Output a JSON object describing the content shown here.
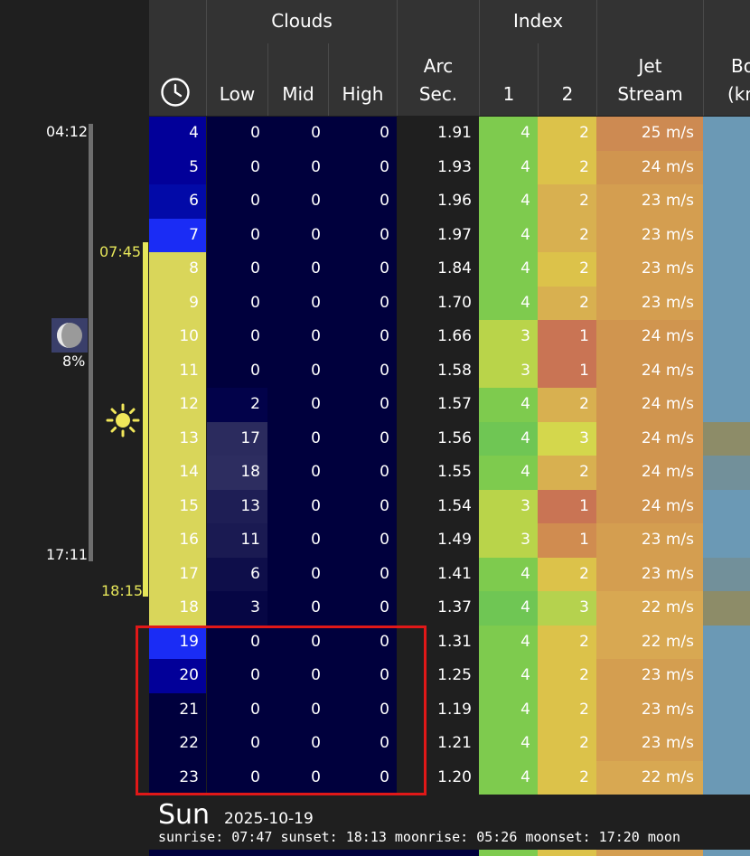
{
  "header": {
    "clouds_label": "Clouds",
    "index_label": "Index",
    "low_label": "Low",
    "mid_label": "Mid",
    "high_label": "High",
    "arc_label_1": "Arc",
    "arc_label_2": "Sec.",
    "index1_label": "1",
    "index2_label": "2",
    "jet_label_1": "Jet",
    "jet_label_2": "Stream",
    "bo_label_1": "Bo",
    "bo_label_2": "(kn"
  },
  "left_panel": {
    "moonrise": "04:12",
    "moonset": "17:11",
    "sunrise": "07:45",
    "sunset": "18:15",
    "moon_illumination": "8%"
  },
  "rows": [
    {
      "hour": "4",
      "low": "0",
      "mid": "0",
      "high": "0",
      "arc": "1.91",
      "i1": "4",
      "i2": "2",
      "jet": "25 m/s",
      "hourColor": "#020099",
      "lowColor": "#00003d",
      "i1Color": "#7ecb4e",
      "i2Color": "#dcc24a",
      "jetColor": "#cd8a52",
      "boColor": "#6b99b5"
    },
    {
      "hour": "5",
      "low": "0",
      "mid": "0",
      "high": "0",
      "arc": "1.93",
      "i1": "4",
      "i2": "2",
      "jet": "24 m/s",
      "hourColor": "#020099",
      "lowColor": "#00003d",
      "i1Color": "#7ecb4e",
      "i2Color": "#dcc24a",
      "jetColor": "#d0954f",
      "boColor": "#6b99b5"
    },
    {
      "hour": "6",
      "low": "0",
      "mid": "0",
      "high": "0",
      "arc": "1.96",
      "i1": "4",
      "i2": "2",
      "jet": "23 m/s",
      "hourColor": "#020aa8",
      "lowColor": "#00003d",
      "i1Color": "#7ecb4e",
      "i2Color": "#d8b050",
      "jetColor": "#d49e50",
      "boColor": "#6b99b5"
    },
    {
      "hour": "7",
      "low": "0",
      "mid": "0",
      "high": "0",
      "arc": "1.97",
      "i1": "4",
      "i2": "2",
      "jet": "23 m/s",
      "hourColor": "#1a2cf5",
      "lowColor": "#00003d",
      "i1Color": "#7ecb4e",
      "i2Color": "#d8b050",
      "jetColor": "#d49e50",
      "boColor": "#6b99b5"
    },
    {
      "hour": "8",
      "low": "0",
      "mid": "0",
      "high": "0",
      "arc": "1.84",
      "i1": "4",
      "i2": "2",
      "jet": "23 m/s",
      "hourColor": "#d9d65a",
      "lowColor": "#00003d",
      "i1Color": "#7ecb4e",
      "i2Color": "#dcc24a",
      "jetColor": "#d49e50",
      "boColor": "#6b99b5"
    },
    {
      "hour": "9",
      "low": "0",
      "mid": "0",
      "high": "0",
      "arc": "1.70",
      "i1": "4",
      "i2": "2",
      "jet": "23 m/s",
      "hourColor": "#d9d65a",
      "lowColor": "#00003d",
      "i1Color": "#7ecb4e",
      "i2Color": "#d8b050",
      "jetColor": "#d49e50",
      "boColor": "#6b99b5"
    },
    {
      "hour": "10",
      "low": "0",
      "mid": "0",
      "high": "0",
      "arc": "1.66",
      "i1": "3",
      "i2": "1",
      "jet": "24 m/s",
      "hourColor": "#d9d65a",
      "lowColor": "#00003d",
      "i1Color": "#b9d44a",
      "i2Color": "#c97454",
      "jetColor": "#d0954f",
      "boColor": "#6b99b5"
    },
    {
      "hour": "11",
      "low": "0",
      "mid": "0",
      "high": "0",
      "arc": "1.58",
      "i1": "3",
      "i2": "1",
      "jet": "24 m/s",
      "hourColor": "#d9d65a",
      "lowColor": "#00003d",
      "i1Color": "#b9d44a",
      "i2Color": "#c97454",
      "jetColor": "#d0954f",
      "boColor": "#6b99b5"
    },
    {
      "hour": "12",
      "low": "2",
      "mid": "0",
      "high": "0",
      "arc": "1.57",
      "i1": "4",
      "i2": "2",
      "jet": "24 m/s",
      "hourColor": "#d9d65a",
      "lowColor": "#02024a",
      "i1Color": "#7ecb4e",
      "i2Color": "#d8b050",
      "jetColor": "#d0954f",
      "boColor": "#6b99b5"
    },
    {
      "hour": "13",
      "low": "17",
      "mid": "0",
      "high": "0",
      "arc": "1.56",
      "i1": "4",
      "i2": "3",
      "jet": "24 m/s",
      "hourColor": "#d9d65a",
      "lowColor": "#2b2b5e",
      "i1Color": "#6fc654",
      "i2Color": "#d4d74c",
      "jetColor": "#d0954f",
      "boColor": "#8d8c68"
    },
    {
      "hour": "14",
      "low": "18",
      "mid": "0",
      "high": "0",
      "arc": "1.55",
      "i1": "4",
      "i2": "2",
      "jet": "24 m/s",
      "hourColor": "#d9d65a",
      "lowColor": "#2d2d60",
      "i1Color": "#7ecb4e",
      "i2Color": "#d8b050",
      "jetColor": "#d0954f",
      "boColor": "#72909a"
    },
    {
      "hour": "15",
      "low": "13",
      "mid": "0",
      "high": "0",
      "arc": "1.54",
      "i1": "3",
      "i2": "1",
      "jet": "24 m/s",
      "hourColor": "#d9d65a",
      "lowColor": "#1e1e55",
      "i1Color": "#b9d44a",
      "i2Color": "#c97454",
      "jetColor": "#d0954f",
      "boColor": "#6b99b5"
    },
    {
      "hour": "16",
      "low": "11",
      "mid": "0",
      "high": "0",
      "arc": "1.49",
      "i1": "3",
      "i2": "1",
      "jet": "23 m/s",
      "hourColor": "#d9d65a",
      "lowColor": "#1a1a52",
      "i1Color": "#b9d44a",
      "i2Color": "#d08c50",
      "jetColor": "#d49e50",
      "boColor": "#6b99b5"
    },
    {
      "hour": "17",
      "low": "6",
      "mid": "0",
      "high": "0",
      "arc": "1.41",
      "i1": "4",
      "i2": "2",
      "jet": "23 m/s",
      "hourColor": "#d9d65a",
      "lowColor": "#0e0e4a",
      "i1Color": "#7ecb4e",
      "i2Color": "#dcc24a",
      "jetColor": "#d49e50",
      "boColor": "#72909a"
    },
    {
      "hour": "18",
      "low": "3",
      "mid": "0",
      "high": "0",
      "arc": "1.37",
      "i1": "4",
      "i2": "3",
      "jet": "22 m/s",
      "hourColor": "#d9d65a",
      "lowColor": "#060644",
      "i1Color": "#6fc654",
      "i2Color": "#b5d24e",
      "jetColor": "#d8a852",
      "boColor": "#8d8c68"
    },
    {
      "hour": "19",
      "low": "0",
      "mid": "0",
      "high": "0",
      "arc": "1.31",
      "i1": "4",
      "i2": "2",
      "jet": "22 m/s",
      "hourColor": "#1a2cf5",
      "lowColor": "#00003d",
      "i1Color": "#7ecb4e",
      "i2Color": "#dcc24a",
      "jetColor": "#d8a852",
      "boColor": "#6b99b5"
    },
    {
      "hour": "20",
      "low": "0",
      "mid": "0",
      "high": "0",
      "arc": "1.25",
      "i1": "4",
      "i2": "2",
      "jet": "23 m/s",
      "hourColor": "#020099",
      "lowColor": "#00003d",
      "i1Color": "#7ecb4e",
      "i2Color": "#dcc24a",
      "jetColor": "#d49e50",
      "boColor": "#6b99b5"
    },
    {
      "hour": "21",
      "low": "0",
      "mid": "0",
      "high": "0",
      "arc": "1.19",
      "i1": "4",
      "i2": "2",
      "jet": "23 m/s",
      "hourColor": "#00003d",
      "lowColor": "#00003d",
      "i1Color": "#7ecb4e",
      "i2Color": "#dcc24a",
      "jetColor": "#d49e50",
      "boColor": "#6b99b5"
    },
    {
      "hour": "22",
      "low": "0",
      "mid": "0",
      "high": "0",
      "arc": "1.21",
      "i1": "4",
      "i2": "2",
      "jet": "23 m/s",
      "hourColor": "#00003d",
      "lowColor": "#00003d",
      "i1Color": "#7ecb4e",
      "i2Color": "#dcc24a",
      "jetColor": "#d49e50",
      "boColor": "#6b99b5"
    },
    {
      "hour": "23",
      "low": "0",
      "mid": "0",
      "high": "0",
      "arc": "1.20",
      "i1": "4",
      "i2": "2",
      "jet": "22 m/s",
      "hourColor": "#00003d",
      "lowColor": "#00003d",
      "i1Color": "#7ecb4e",
      "i2Color": "#dcc24a",
      "jetColor": "#d8a852",
      "boColor": "#6b99b5"
    }
  ],
  "footer": {
    "day": "Sun",
    "date": "2025-10-19",
    "info": "sunrise: 07:47 sunset: 18:13 moonrise: 05:26 moonset: 17:20 moon"
  },
  "colors": {
    "background": "#1f1f1f",
    "header_bg": "#333333",
    "cloud_dark": "#00003d",
    "daylight_yellow": "#d9d65a",
    "highlight_red": "#e01818",
    "moon_bar": "#6e6e6e"
  }
}
